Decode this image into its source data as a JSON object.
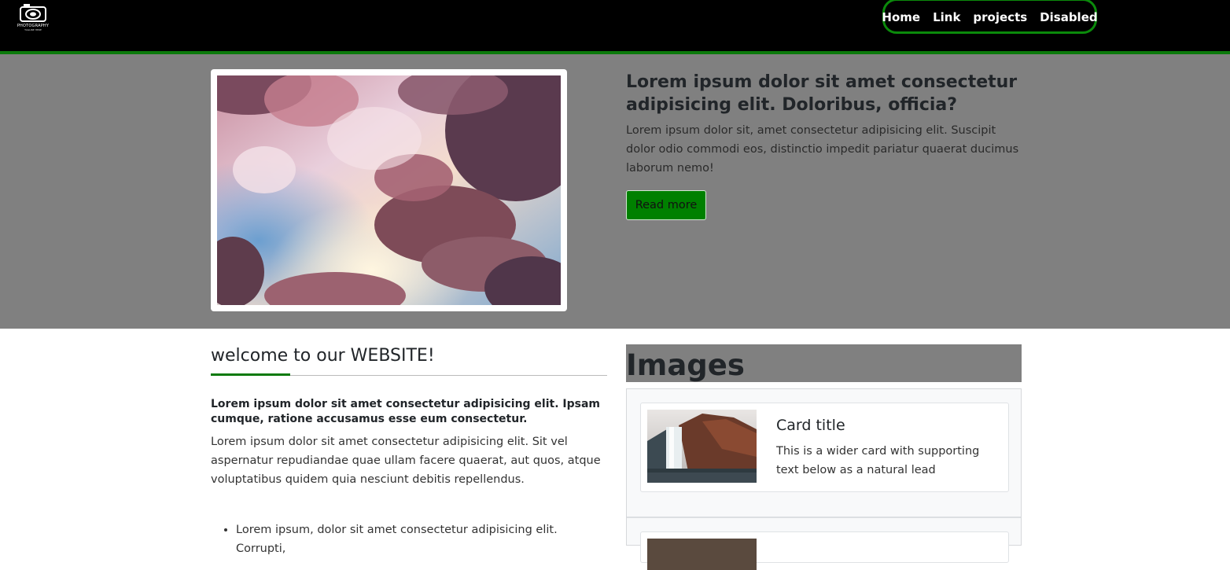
{
  "navbar": {
    "logo_text": "PHOTOGRAPHY",
    "logo_subtext": "TAGLINE HERE",
    "links": [
      "Home",
      "Link",
      "projects",
      "Disabled"
    ],
    "accent_color": "#0b7a0b"
  },
  "hero": {
    "image_icon": "clouds-sky-photo",
    "title": "Lorem ipsum dolor sit amet consectetur adipisicing elit. Doloribus, officia?",
    "text": "Lorem ipsum dolor sit, amet consectetur adipisicing elit. Suscipit dolor odio commodi eos, distinctio impedit pariatur quaerat ducimus laborum nemo!",
    "button_label": "Read more",
    "button_color": "#008000"
  },
  "welcome": {
    "title": "welcome to our WEBSITE!",
    "lead": "Lorem ipsum dolor sit amet consectetur adipisicing elit. Ipsam cumque, ratione accusamus esse eum consectetur.",
    "text": "Lorem ipsum dolor sit amet consectetur adipisicing elit. Sit vel aspernatur repudiandae quae ullam facere quaerat, aut quos, atque voluptatibus quidem quia nesciunt debitis repellendus.",
    "list": [
      "Lorem ipsum, dolor sit amet consectetur adipisicing elit. Corrupti,"
    ]
  },
  "images": {
    "heading": "Images",
    "cards": [
      {
        "image_icon": "waterfall-photo",
        "title": "Card title",
        "text": "This is a wider card with supporting text below as a natural lead"
      }
    ]
  }
}
